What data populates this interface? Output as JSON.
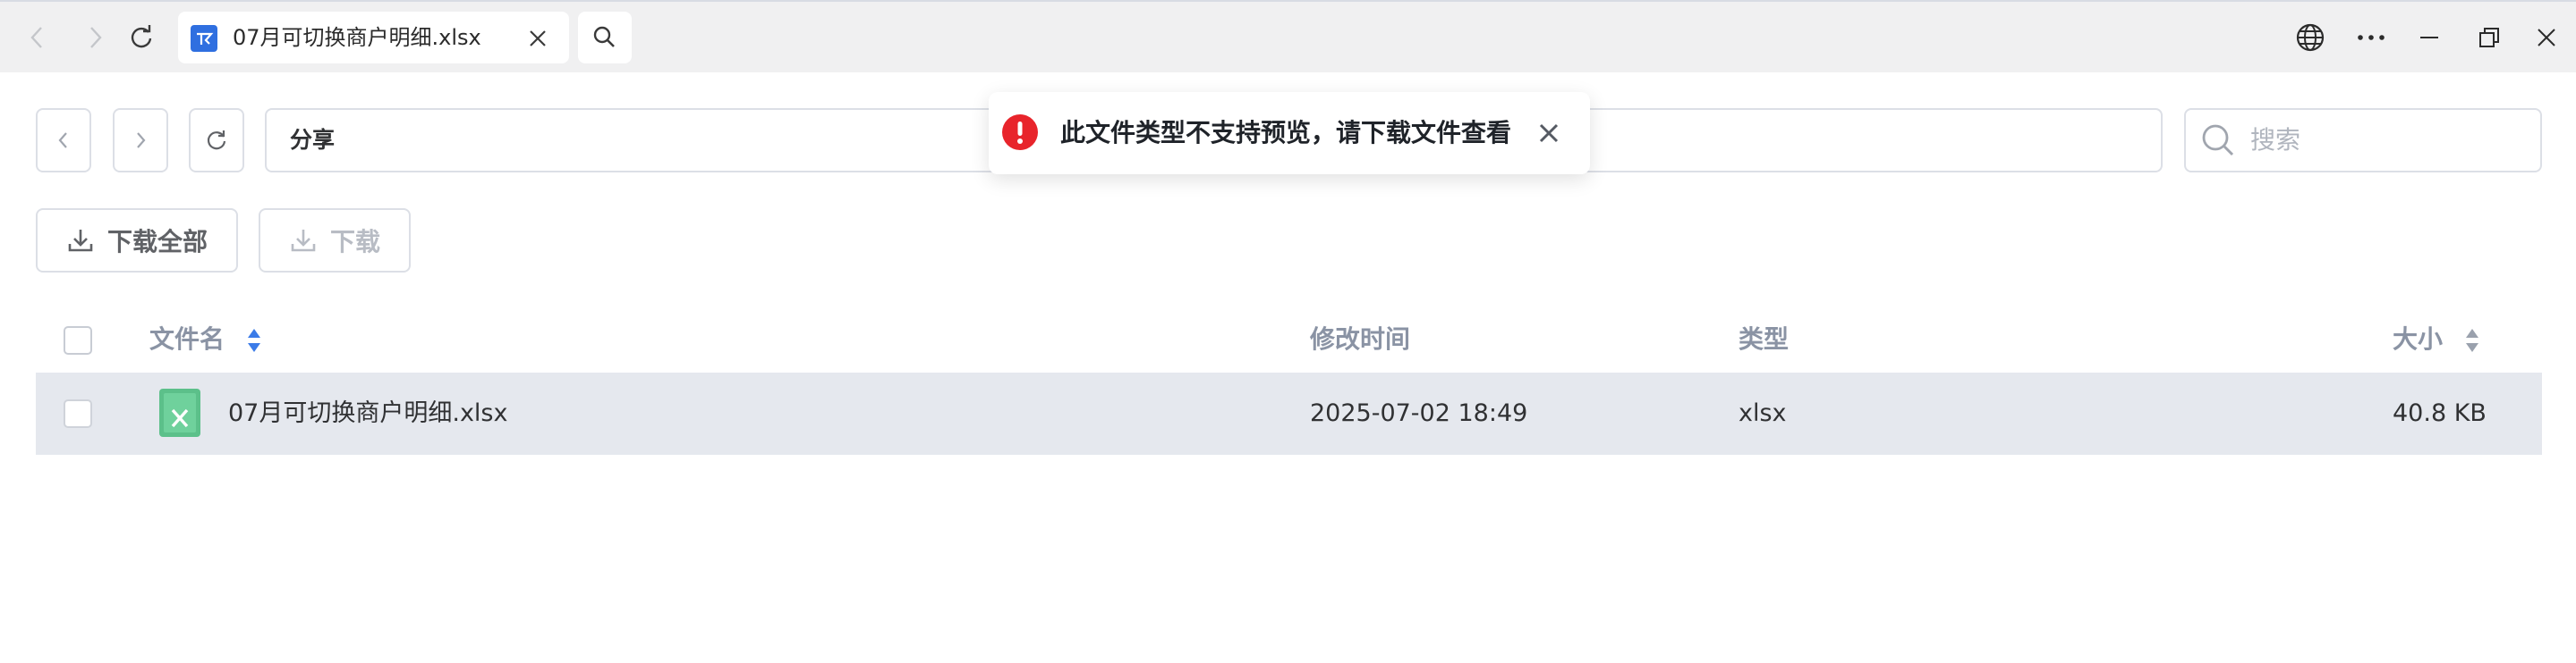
{
  "browser": {
    "tab_title": "07月可切换商户明细.xlsx",
    "icons": {
      "back": "back-arrow-icon",
      "forward": "forward-arrow-icon",
      "refresh": "refresh-icon",
      "favicon": "tab-favicon-icon",
      "tab_close": "close-icon",
      "search": "search-icon",
      "translate": "globe-icon",
      "more": "more-icon",
      "minimize": "minimize-icon",
      "restore": "restore-icon",
      "close": "close-icon"
    }
  },
  "toolbar": {
    "path": "分享",
    "search_placeholder": "搜索",
    "download_all_label": "下载全部",
    "download_label": "下载"
  },
  "table": {
    "columns": [
      "文件名",
      "修改时间",
      "类型",
      "大小"
    ],
    "rows": [
      {
        "name": "07月可切换商户明细.xlsx",
        "modified": "2025-07-02 18:49",
        "type": "xlsx",
        "size": "40.8 KB",
        "icon": "excel-file-icon"
      }
    ]
  },
  "toast": {
    "message": "此文件类型不支持预览，请下载文件查看",
    "type": "error"
  },
  "colors": {
    "accent": "#3b7be8",
    "error": "#e8242b",
    "row_highlight": "#e5e8ee",
    "excel": "#5cc08a"
  }
}
